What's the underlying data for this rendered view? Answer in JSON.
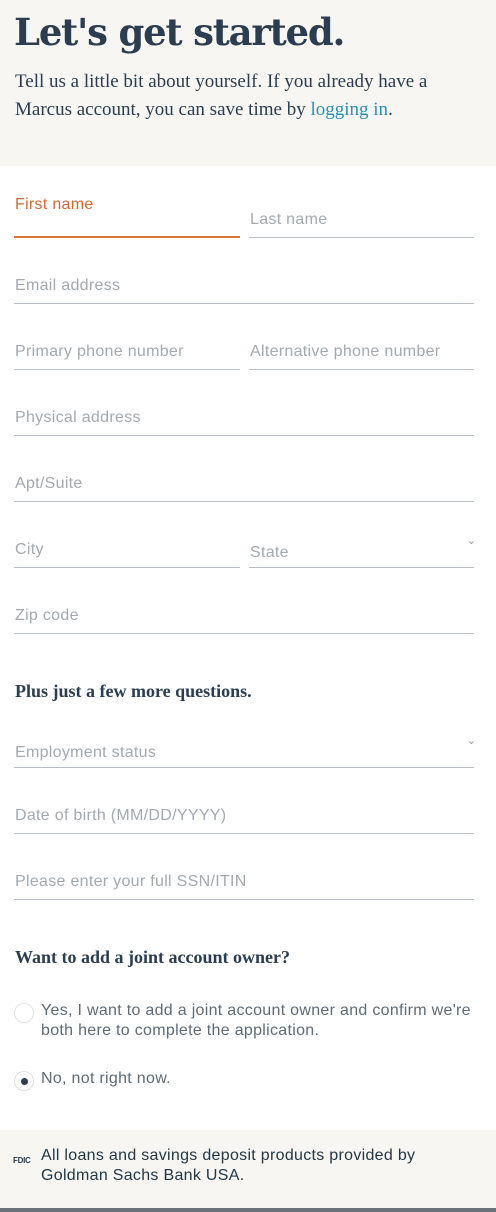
{
  "intro": {
    "headline": "Let's get started.",
    "lead_text": "Tell us a little bit about yourself. If you already have a Marcus account, you can save time by",
    "login_link": "logging in",
    "lead_end": "."
  },
  "form": {
    "first_name": {
      "label": "First name",
      "value": ""
    },
    "last_name": {
      "placeholder": "Last name",
      "value": ""
    },
    "email": {
      "placeholder": "Email address",
      "value": ""
    },
    "primary_phone": {
      "placeholder": "Primary phone number",
      "value": ""
    },
    "alt_phone": {
      "placeholder": "Alternative phone number",
      "value": ""
    },
    "address": {
      "placeholder": "Physical address",
      "value": ""
    },
    "apt": {
      "placeholder": "Apt/Suite",
      "value": ""
    },
    "city": {
      "placeholder": "City",
      "value": ""
    },
    "state": {
      "placeholder": "State"
    },
    "zip": {
      "placeholder": "Zip code",
      "value": ""
    }
  },
  "more": {
    "title": "Plus just a few more questions.",
    "employment": {
      "placeholder": "Employment status"
    },
    "dob": {
      "placeholder": "Date of birth (MM/DD/YYYY)",
      "value": ""
    },
    "ssn": {
      "placeholder": "Please enter your full SSN/ITIN",
      "value": ""
    }
  },
  "joint": {
    "title": "Want to add a joint account owner?",
    "options": [
      {
        "label": "Yes, I want to add a joint account owner and confirm we're both here to complete the application.",
        "checked": false
      },
      {
        "label": "No, not right now.",
        "checked": true
      }
    ]
  },
  "footer": {
    "fdic_logo": "FDIC",
    "note": "All loans and savings deposit products provided by Goldman Sachs Bank USA."
  },
  "colors": {
    "accent": "#d9773f",
    "link": "#2e8fb4",
    "heading": "#2b3d4f",
    "placeholder": "#a3aab0"
  },
  "icons": [
    "chevron-down-icon",
    "radio-icon",
    "fdic-logo"
  ]
}
